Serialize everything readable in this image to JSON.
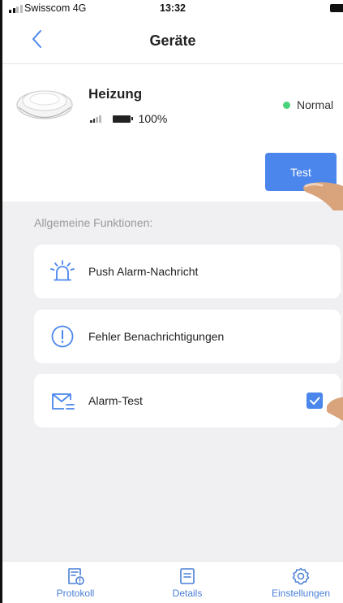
{
  "status_bar": {
    "carrier": "Swisscom 4G",
    "time": "13:32"
  },
  "nav": {
    "title": "Geräte"
  },
  "device": {
    "name": "Heizung",
    "battery": "100%",
    "status": "Normal",
    "status_color": "#4bd37b",
    "test_label": "Test"
  },
  "section_label": "Allgemeine Funktionen:",
  "items": [
    {
      "label": "Push Alarm-Nachricht",
      "icon": "siren-icon"
    },
    {
      "label": "Fehler Benachrichtigungen",
      "icon": "exclamation-circle-icon"
    },
    {
      "label": "Alarm-Test",
      "icon": "envelope-icon",
      "checked": true
    }
  ],
  "tabs": [
    {
      "label": "Protokoll",
      "icon": "protocol-icon"
    },
    {
      "label": "Details",
      "icon": "details-icon"
    },
    {
      "label": "Einstellungen",
      "icon": "settings-gear-icon"
    }
  ],
  "accent": "#4a86ec"
}
